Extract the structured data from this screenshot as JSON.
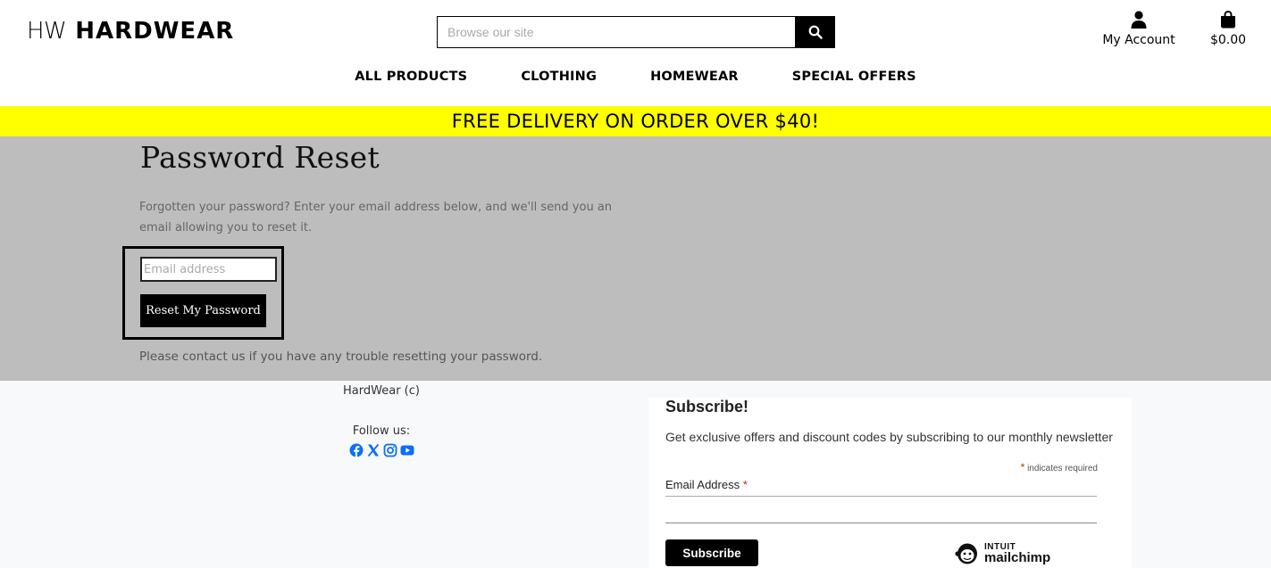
{
  "brand": {
    "prefix": "HW",
    "name": "HARDWEAR"
  },
  "search": {
    "placeholder": "Browse our site"
  },
  "account": {
    "label": "My Account"
  },
  "cart": {
    "total": "$0.00"
  },
  "nav": [
    {
      "label": "ALL PRODUCTS"
    },
    {
      "label": "CLOTHING"
    },
    {
      "label": "HOMEWEAR"
    },
    {
      "label": "SPECIAL OFFERS"
    }
  ],
  "banner": {
    "text": "FREE DELIVERY ON ORDER OVER $40!"
  },
  "reset": {
    "title": "Password Reset",
    "intro": "Forgotten your password? Enter your email address below, and we'll send you an email allowing you to reset it.",
    "email_placeholder": "Email address",
    "button_label": "Reset My Password",
    "contact_text": "Please contact us if you have any trouble resetting your password."
  },
  "footer": {
    "copyright": "HardWear (c)",
    "follow_label": "Follow us:",
    "social": [
      "facebook-icon",
      "x-icon",
      "instagram-icon",
      "youtube-icon"
    ],
    "social_color": "#0d6efd"
  },
  "subscribe": {
    "title": "Subscribe!",
    "description": "Get exclusive offers and discount codes by subscribing to our monthly newsletter",
    "required_marker": "*",
    "required_note": "indicates required",
    "email_label": "Email Address",
    "button_label": "Subscribe",
    "provider_top": "INTUIT",
    "provider_name": "mailchimp"
  },
  "colors": {
    "banner": "#ffff00",
    "overlay": "#bdbdbd",
    "required": "#c02b0a"
  }
}
